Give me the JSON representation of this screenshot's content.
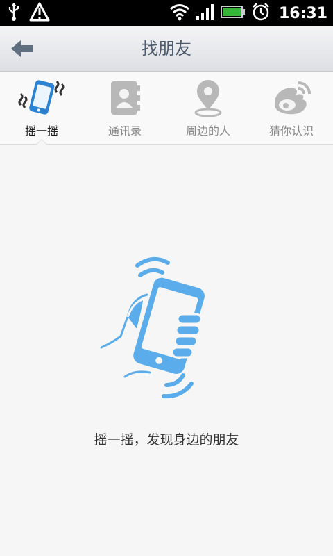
{
  "status_bar": {
    "time": "16:31",
    "icons": [
      "usb-icon",
      "warning-icon",
      "wifi-icon",
      "signal-icon",
      "battery-icon",
      "alarm-icon"
    ]
  },
  "header": {
    "title": "找朋友",
    "back_icon": "back-arrow-icon"
  },
  "tabs": [
    {
      "label": "摇一摇",
      "icon": "shake-phone-icon",
      "active": true
    },
    {
      "label": "通讯录",
      "icon": "contacts-book-icon",
      "active": false
    },
    {
      "label": "周边的人",
      "icon": "location-pin-icon",
      "active": false
    },
    {
      "label": "猜你认识",
      "icon": "weibo-icon",
      "active": false
    }
  ],
  "main": {
    "hint": "摇一摇，发现身边的朋友",
    "illustration": "hand-shaking-phone"
  },
  "colors": {
    "accent": "#5aacea",
    "inactive_icon": "#b8b8b8",
    "title": "#4d5b6c"
  }
}
